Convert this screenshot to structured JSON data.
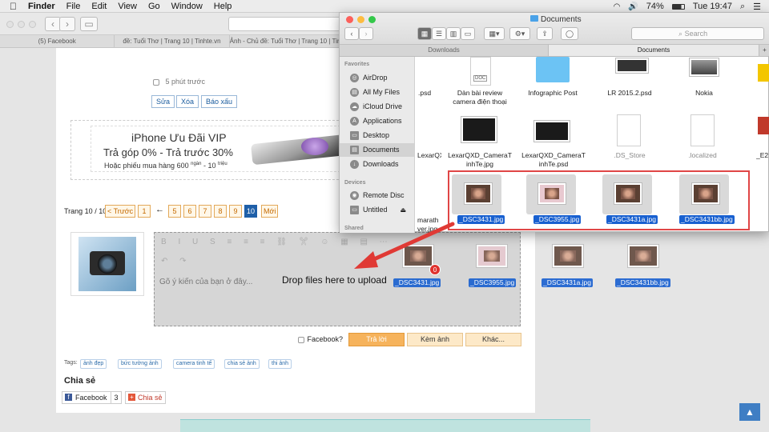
{
  "menubar": {
    "app": "Finder",
    "items": [
      "File",
      "Edit",
      "View",
      "Go",
      "Window",
      "Help"
    ],
    "battery": "74%",
    "clock": "Tue 19:47"
  },
  "browser": {
    "tabs": [
      "(5) Facebook",
      "đề: Tuổi Thơ | Trang 10 | Tinhte.vn",
      "Ảnh - Chủ đề: Tuổi Thơ | Trang 10 | Tinhte.vn"
    ]
  },
  "post": {
    "checkbox_label": "5 phút trước",
    "actions": [
      "Sửa",
      "Xóa",
      "Báo xấu"
    ]
  },
  "ad": {
    "line1": "iPhone Ưu Đãi VIP",
    "line2": "Trả góp 0% - Trả trước 30%",
    "line3_a": "Hoặc phiếu mua hàng 600",
    "line3_b": "ngàn",
    "line3_c": "- 10",
    "line3_d": "triệu"
  },
  "pagination": {
    "label": "Trang 10 / 10",
    "prev": "< Trước",
    "arrow": "←",
    "pages": [
      "1",
      "5",
      "6",
      "7",
      "8",
      "9",
      "10"
    ],
    "current": "10",
    "new": "Mới"
  },
  "editor": {
    "toolbar": "B I U S ≡ ≡ ≡ ⛓ ✂ ☺ ▦ ▤ ⋯",
    "toolbar2": "↶ ↷",
    "placeholder": "Gõ ý kiến của bạn ở đây...",
    "drop_text": "Drop files here to upload"
  },
  "reply": {
    "facebook_label": "Facebook?",
    "reply": "Trả lời",
    "attach": "Kèm ảnh",
    "other": "Khác..."
  },
  "tags": {
    "label": "Tags:",
    "items": [
      "ảnh đẹp",
      "bức tường ảnh",
      "camera tinh tế",
      "chia sẻ ảnh",
      "thi ảnh"
    ]
  },
  "share": {
    "title": "Chia sẻ",
    "facebook": "Facebook",
    "facebook_count": "3",
    "other": "Chia sẻ"
  },
  "finder": {
    "title": "Documents",
    "search_placeholder": "Search",
    "tabs": [
      "Downloads",
      "Documents"
    ],
    "add_tab": "+",
    "sidebar": {
      "favorites_head": "Favorites",
      "favorites": [
        "AirDrop",
        "All My Files",
        "iCloud Drive",
        "Applications",
        "Desktop",
        "Documents",
        "Downloads"
      ],
      "selected": "Documents",
      "devices_head": "Devices",
      "devices": [
        "Remote Disc",
        "Untitled"
      ],
      "shared_head": "Shared"
    },
    "files_row1": [
      ".psd",
      "Dàn bài review camera điện thoại",
      "Infographic Post",
      "LR 2015.2.psd",
      "Nokia"
    ],
    "files_row2": [
      "LexarQXD_CameraT inhTe.jpg",
      "LexarQXD_CameraT inhTe.psd",
      ".DS_Store",
      ".localized",
      "_E2"
    ],
    "files_row2_left": "LexarQXD_CameraT",
    "selected_files": [
      "_DSC3431.jpg",
      "_DSC3955.jpg",
      "_DSC3431a.jpg",
      "_DSC3431bb.jpg"
    ],
    "partial_row3": [
      "marath",
      "ver.jpg"
    ],
    "doc_icon_text": "DOC"
  },
  "dragged": {
    "files": [
      "_DSC3431.jpg",
      "_DSC3955.jpg",
      "_DSC3431a.jpg",
      "_DSC3431bb.jpg"
    ],
    "badge": "0"
  }
}
